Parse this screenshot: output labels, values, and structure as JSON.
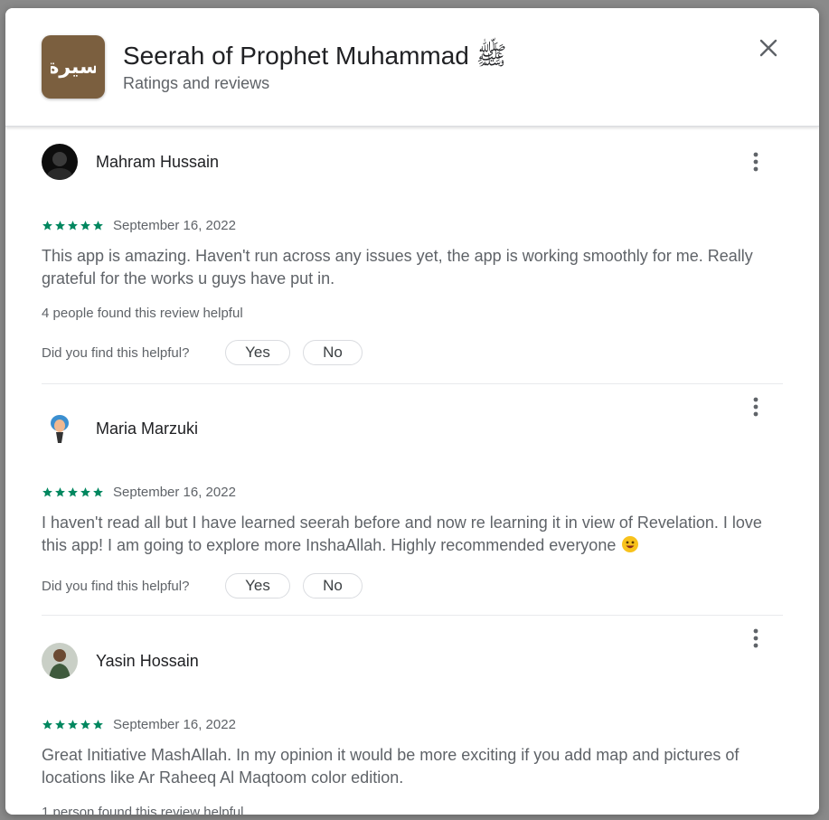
{
  "app": {
    "title": "Seerah of Prophet Muhammad ﷺ",
    "subtitle": "Ratings and reviews",
    "icon_name": "seerah-app-logo",
    "icon_text": "سيرة",
    "icon_color": "#7b5f3f"
  },
  "dialog": {
    "close_icon": "close-icon"
  },
  "star_color": "#01875f",
  "reviews": [
    {
      "name": "Mahram Hussain",
      "rating": 5,
      "date": "September 16, 2022",
      "text": "This app is amazing. Haven't run across any issues yet, the app is working smoothly for me. Really grateful for the works u guys have put in.",
      "helpful_count": "4 people found this review helpful",
      "helpful_question": "Did you find this helpful?",
      "yes_label": "Yes",
      "no_label": "No"
    },
    {
      "name": "Maria Marzuki",
      "rating": 5,
      "date": "September 16, 2022",
      "text": "I haven't read all but I have learned seerah before and now re learning it in view of Revelation. I love this app! I am going to explore more InshaAllah. Highly recommended everyone",
      "helpful_question": "Did you find this helpful?",
      "yes_label": "Yes",
      "no_label": "No"
    },
    {
      "name": "Yasin Hossain",
      "rating": 5,
      "date": "September 16, 2022",
      "text": "Great Initiative MashAllah. In my opinion it would be more exciting if you add map and pictures of locations like Ar Raheeq Al Maqtoom color edition.",
      "helpful_count": "1 person found this review helpful"
    }
  ]
}
